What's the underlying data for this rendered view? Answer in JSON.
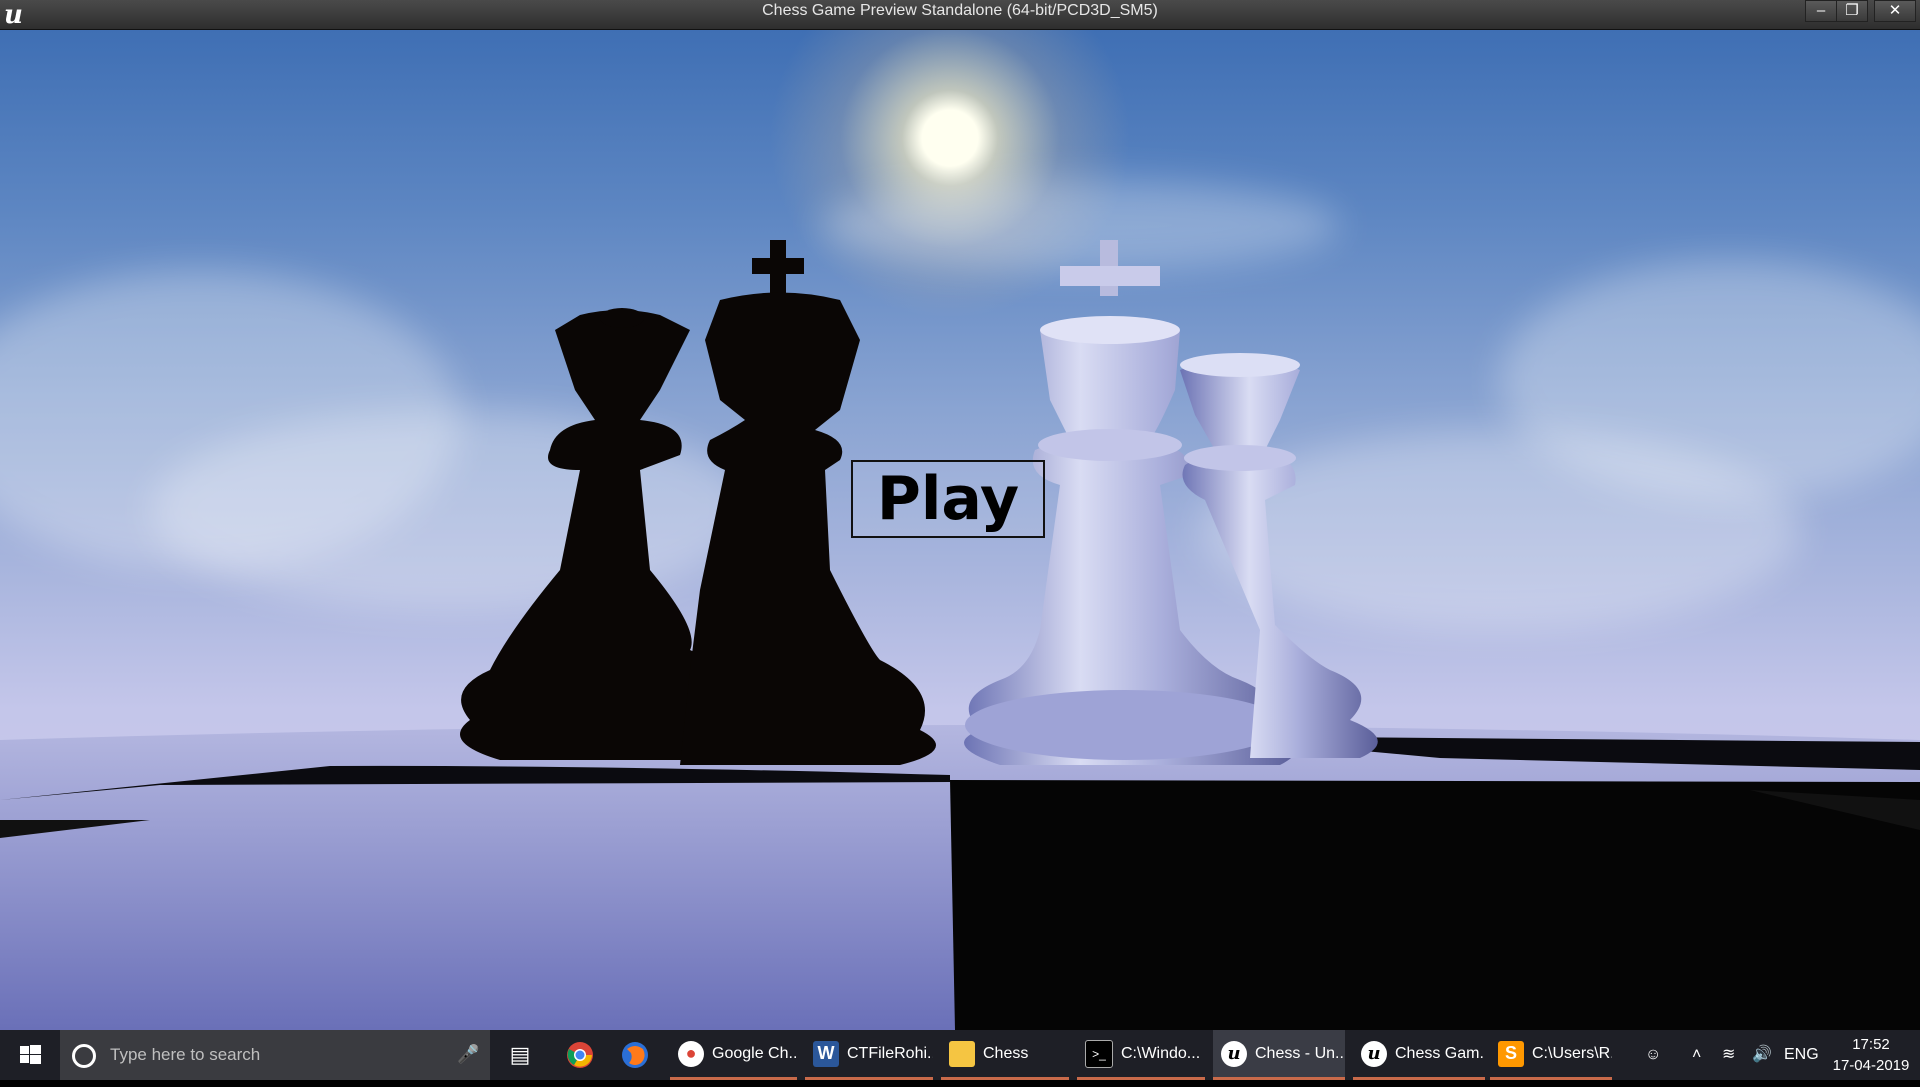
{
  "window": {
    "title": "Chess Game Preview Standalone (64-bit/PCD3D_SM5)",
    "buttons": [
      "minimize",
      "restore",
      "close"
    ]
  },
  "scene": {
    "play_label": "Play"
  },
  "taskbar": {
    "search_placeholder": "Type here to search",
    "items": [
      {
        "label": "Google Ch...",
        "icon": "chrome-icon"
      },
      {
        "label": "CTFileRohi...",
        "icon": "word-icon"
      },
      {
        "label": "Chess",
        "icon": "folder-icon"
      },
      {
        "label": "C:\\Windo...",
        "icon": "cmd-icon"
      },
      {
        "label": "Chess - Un...",
        "icon": "unreal-icon"
      },
      {
        "label": "Chess Gam...",
        "icon": "unreal-icon"
      },
      {
        "label": "C:\\Users\\R...",
        "icon": "sublime-icon"
      }
    ],
    "lang": "ENG",
    "time": "17:52",
    "date": "17-04-2019"
  },
  "colors": {
    "sky_top": "#3f6fb4",
    "sky_bottom": "#d2cdee",
    "taskbar": "#1e1f26",
    "active_underline": "#c86a4a"
  }
}
